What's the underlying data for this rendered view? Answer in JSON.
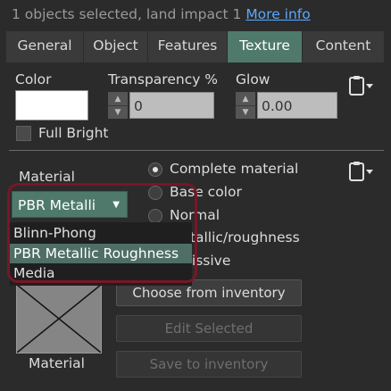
{
  "status": {
    "selection_text": "1 objects selected, land impact 1",
    "more_info_link": "More info"
  },
  "tabs": [
    {
      "label": "General",
      "active": false
    },
    {
      "label": "Object",
      "active": false
    },
    {
      "label": "Features",
      "active": false
    },
    {
      "label": "Texture",
      "active": true
    },
    {
      "label": "Content",
      "active": false
    }
  ],
  "texture": {
    "color_label": "Color",
    "color_value": "#ffffff",
    "transparency_label": "Transparency %",
    "transparency_value": "0",
    "glow_label": "Glow",
    "glow_value": "0.00",
    "full_bright_label": "Full Bright",
    "full_bright_checked": false
  },
  "material": {
    "section_label": "Material",
    "combo_value": "PBR Metalli",
    "dropdown_options": [
      "Blinn-Phong",
      "PBR Metallic Roughness",
      "Media"
    ],
    "dropdown_selected_index": 1,
    "radio_options": [
      {
        "label": "Complete material",
        "checked": true
      },
      {
        "label": "Base color",
        "checked": false
      },
      {
        "label": "Normal",
        "checked": false
      },
      {
        "label": "Metallic/roughness",
        "checked": false
      },
      {
        "label": "Emissive",
        "checked": false
      }
    ],
    "buttons": [
      {
        "label": "Choose from inventory",
        "enabled": true
      },
      {
        "label": "Edit Selected",
        "enabled": false
      },
      {
        "label": "Save to inventory",
        "enabled": false
      }
    ],
    "thumbnail_label": "Material"
  },
  "colors": {
    "accent": "#4f7a6b",
    "link": "#5aa9ff",
    "highlight_ring": "#7a1528"
  }
}
